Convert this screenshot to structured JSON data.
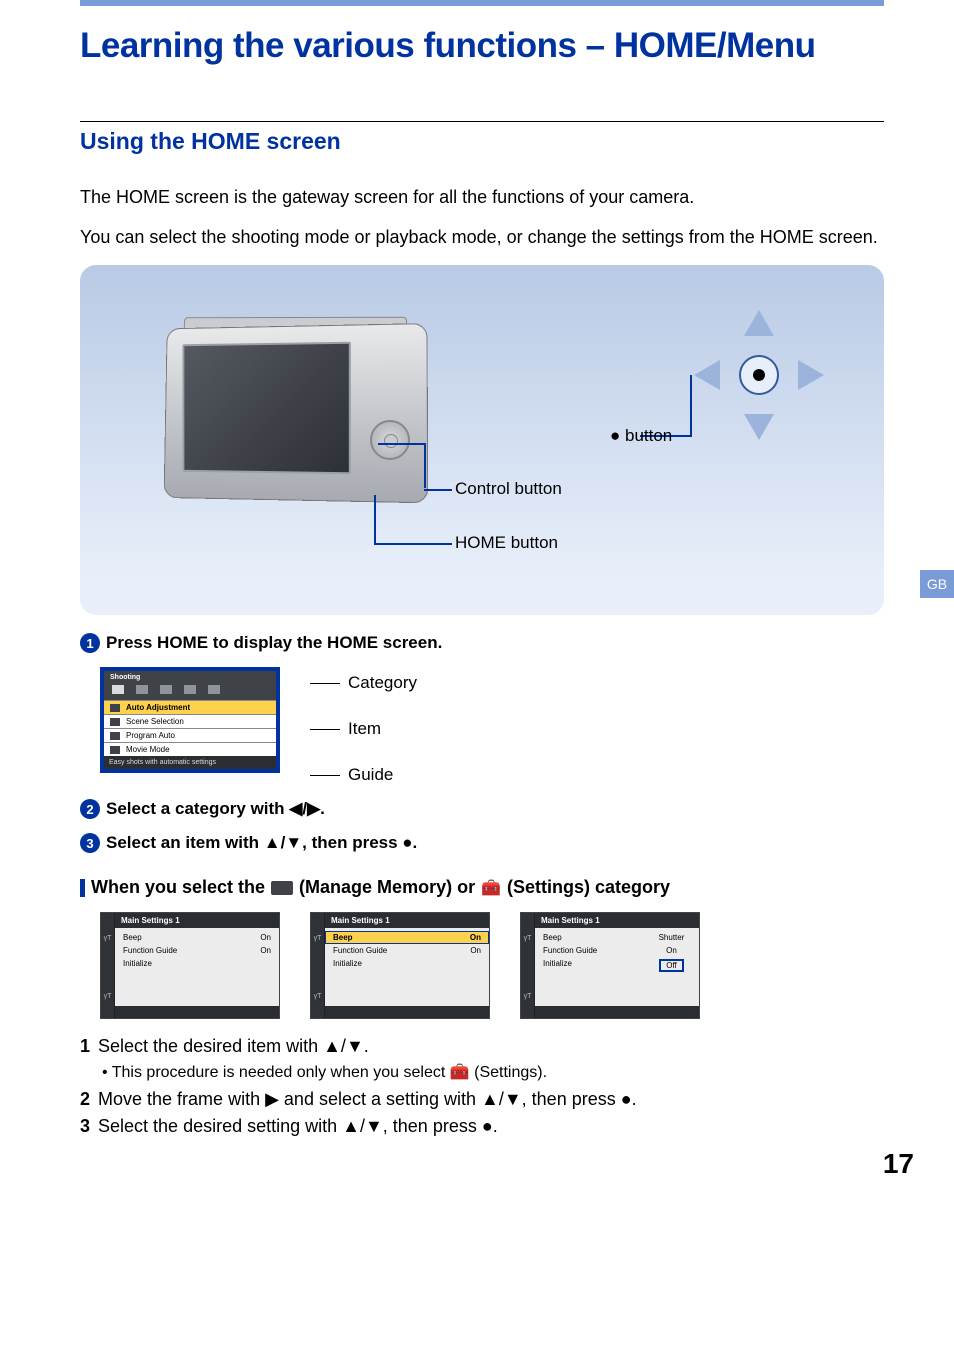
{
  "page_title": "Learning the various functions – HOME/Menu",
  "section": "Using the HOME screen",
  "intro1": "The HOME screen is the gateway screen for all the functions of your camera.",
  "intro2": "You can select the shooting mode or playback mode, or change the settings from the HOME screen.",
  "diagram": {
    "dot_button": "● button",
    "control_button": "Control button",
    "home_button": "HOME button"
  },
  "side_tab": "GB",
  "steps": [
    "Press HOME to display the HOME screen.",
    " Select a category with ◀/▶.",
    " Select an item with ▲/▼, then press ●."
  ],
  "home_mini": {
    "title": "Shooting",
    "items": [
      "Auto Adjustment",
      "Scene Selection",
      "Program Auto",
      "Movie Mode"
    ],
    "guide": "Easy shots with automatic settings"
  },
  "mini_labels": {
    "category": "Category",
    "item": "Item",
    "guide": "Guide"
  },
  "sub_heading_pre": "When you select the ",
  "sub_heading_mid": " (Manage Memory) or ",
  "sub_heading_post": " (Settings) category",
  "settings_title": "Main Settings 1",
  "settings_rows": {
    "beep": "Beep",
    "fg": "Function Guide",
    "init": "Initialize",
    "on": "On",
    "shutter": "Shutter",
    "off": "Off"
  },
  "numbered": {
    "s1a": " Select the desired item with ▲/▼.",
    "s1_bullet": "• This procedure is needed only when you select ",
    "s1_bullet_tail": " (Settings).",
    "s2": " Move the frame with ▶ and select a setting with ▲/▼, then press ●.",
    "s3": " Select the desired setting with ▲/▼, then press ●."
  },
  "page_number": "17"
}
